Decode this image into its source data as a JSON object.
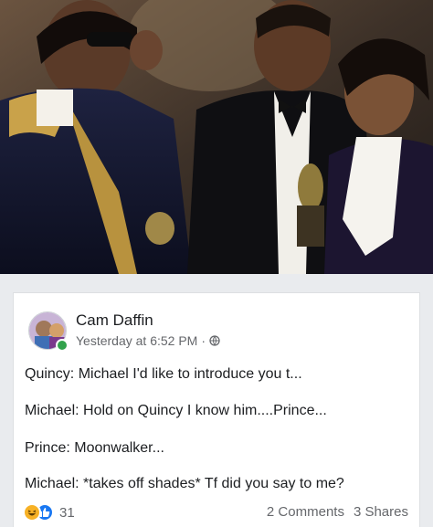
{
  "post": {
    "author": "Cam Daffin",
    "timestamp": "Yesterday at 6:52 PM",
    "separator": "·",
    "privacy_icon": "globe-icon",
    "lines": [
      "Quincy: Michael I'd like to introduce you t...",
      "Michael: Hold on Quincy I know him....Prince...",
      "Prince: Moonwalker...",
      "Michael: *takes off shades* Tf did you say to me?"
    ],
    "reactions": {
      "icons": [
        "haha-icon",
        "like-icon"
      ],
      "count": "31"
    },
    "comments": "2 Comments",
    "shares": "3 Shares"
  },
  "colors": {
    "like_blue": "#1877f2",
    "haha_yellow": "#f7b125",
    "online_green": "#31a24c",
    "secondary_text": "#65676b"
  }
}
